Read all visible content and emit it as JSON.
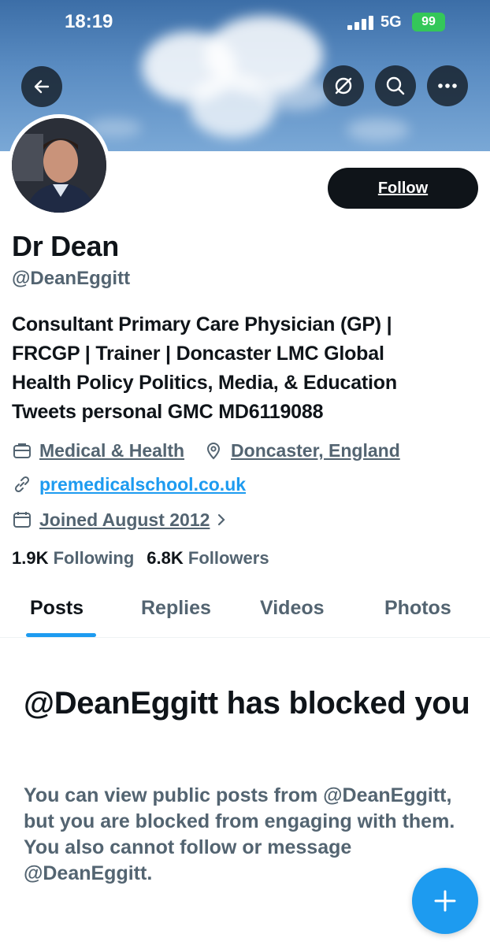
{
  "status_bar": {
    "time": "18:19",
    "network": "5G",
    "battery": "99"
  },
  "nav": {
    "back_icon": "arrow-left-icon",
    "grok_icon": "grok-icon",
    "search_icon": "search-icon",
    "more_icon": "more-horizontal-icon"
  },
  "profile": {
    "name": "Dr Dean",
    "handle": "@DeanEggitt",
    "follow_label": "Follow",
    "bio_lines": [
      "Consultant Primary Care Physician (GP) |",
      "FRCGP | Trainer | Doncaster LMC Global",
      "Health Policy Politics, Media, & Education",
      "Tweets personal GMC MD6119088"
    ],
    "category": "Medical & Health",
    "location": "Doncaster, England",
    "website": "premedicalschool.co.uk",
    "joined": "Joined August 2012",
    "following_count": "1.9K",
    "following_label": "Following",
    "followers_count": "6.8K",
    "followers_label": "Followers"
  },
  "tabs": [
    {
      "label": "Posts",
      "active": true
    },
    {
      "label": "Replies",
      "active": false
    },
    {
      "label": "Videos",
      "active": false
    },
    {
      "label": "Photos",
      "active": false
    }
  ],
  "blocked": {
    "title": "@DeanEggitt has blocked you",
    "description": "You can view public posts from @DeanEggitt, but you are blocked from engaging with them. You also cannot follow or message @DeanEggitt."
  },
  "fab_icon": "plus-icon",
  "colors": {
    "accent": "#1d9bf0",
    "text": "#0f1419",
    "muted": "#536471"
  }
}
